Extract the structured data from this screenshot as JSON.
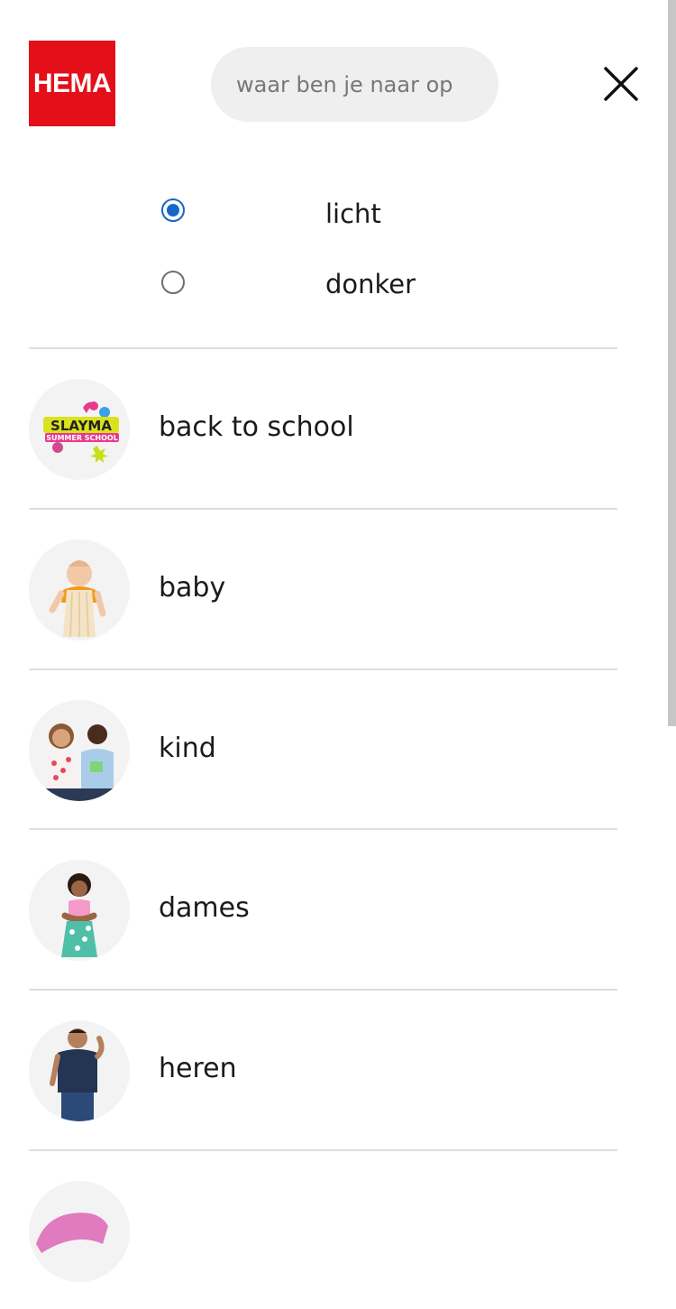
{
  "header": {
    "logo_text": "HEMA",
    "search_placeholder": "waar ben je naar op",
    "close_icon": "close-icon",
    "brand_color": "#e3101a"
  },
  "theme": {
    "options": [
      {
        "label": "licht",
        "selected": true
      },
      {
        "label": "donker",
        "selected": false
      }
    ],
    "accent_color": "#1666cc"
  },
  "categories": [
    {
      "label": "back to school",
      "icon": "slayma-summer-school-logo"
    },
    {
      "label": "baby",
      "icon": "baby-photo"
    },
    {
      "label": "kind",
      "icon": "kids-photo"
    },
    {
      "label": "dames",
      "icon": "woman-photo"
    },
    {
      "label": "heren",
      "icon": "man-photo"
    },
    {
      "label": "",
      "icon": "pink-clothing-photo"
    }
  ]
}
